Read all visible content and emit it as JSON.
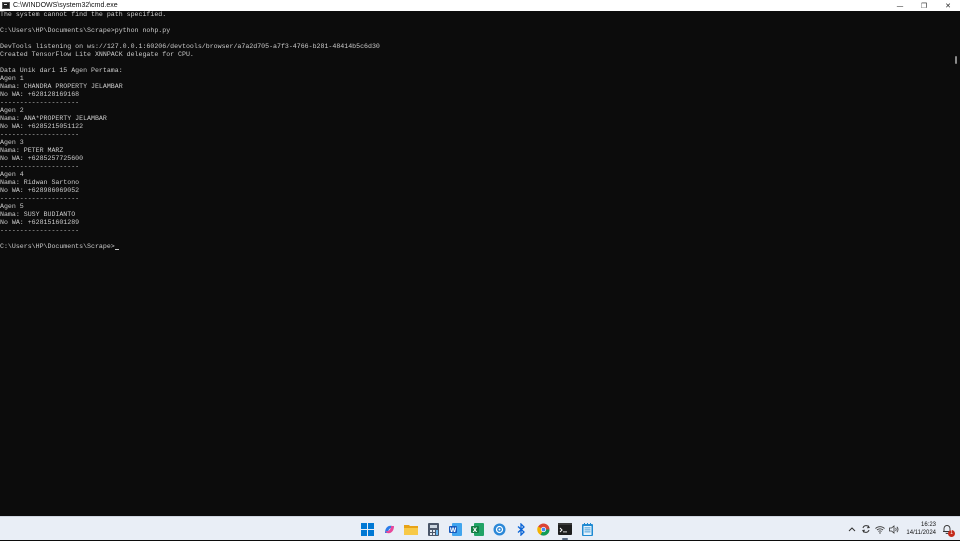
{
  "window": {
    "title": "C:\\WINDOWS\\system32\\cmd.exe",
    "minimize_glyph": "—",
    "maximize_glyph": "❐",
    "close_glyph": "✕"
  },
  "console": {
    "lines": [
      "The system cannot find the path specified.",
      "",
      "C:\\Users\\HP\\Documents\\Scrape>python nohp.py",
      "",
      "DevTools listening on ws://127.0.0.1:60206/devtools/browser/a7a2d705-a7f3-4766-b281-48414b5c6d30",
      "Created TensorFlow Lite XNNPACK delegate for CPU.",
      "",
      "Data Unik dari 15 Agen Pertama:",
      "Agen 1",
      "Nama: CHANDRA PROPERTY JELAMBAR",
      "No WA: +628128169168",
      "--------------------",
      "Agen 2",
      "Nama: ANA*PROPERTY JELAMBAR",
      "No WA: +6285215051122",
      "--------------------",
      "Agen 3",
      "Nama: PETER MARZ",
      "No WA: +6285257725600",
      "--------------------",
      "Agen 4",
      "Nama: Ridwan Sartono",
      "No WA: +628986069052",
      "--------------------",
      "Agen 5",
      "Nama: SUSY BUDIANTO",
      "No WA: +628151601289",
      "--------------------",
      ""
    ],
    "prompt": "C:\\Users\\HP\\Documents\\Scrape>"
  },
  "taskbar": {
    "apps": [
      {
        "name": "start-icon",
        "color": "#0078d4"
      },
      {
        "name": "copilot-icon",
        "color": "#7b5cf0"
      },
      {
        "name": "file-explorer-icon",
        "color": "#f2b833"
      },
      {
        "name": "calculator-icon",
        "color": "#4a5568"
      },
      {
        "name": "word-icon",
        "color": "#185abd"
      },
      {
        "name": "excel-icon",
        "color": "#107c41"
      },
      {
        "name": "network-app-icon",
        "color": "#2b88d8"
      },
      {
        "name": "bluetooth-icon",
        "color": "#0a64d6"
      },
      {
        "name": "chrome-icon",
        "color": "#db4437"
      },
      {
        "name": "terminal-icon",
        "color": "#1e1e1e"
      },
      {
        "name": "notepad-icon",
        "color": "#1f8ad2"
      }
    ],
    "clock": {
      "time": "16:23",
      "date": "14/11/2024"
    },
    "notification_count": "1"
  }
}
